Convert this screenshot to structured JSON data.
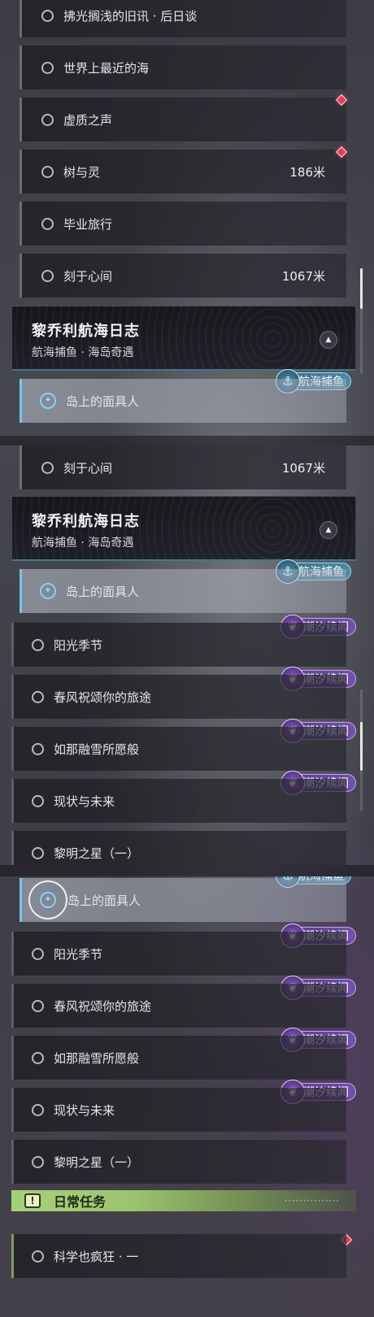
{
  "panel1": {
    "rows": [
      {
        "label": "拂光搁浅的旧讯 · 后日谈",
        "distance": ""
      },
      {
        "label": "世界上最近的海",
        "distance": ""
      },
      {
        "label": "虚质之声",
        "distance": ""
      },
      {
        "label": "树与灵",
        "distance": "186米"
      },
      {
        "label": "毕业旅行",
        "distance": ""
      },
      {
        "label": "刻于心间",
        "distance": "1067米"
      }
    ],
    "header": {
      "title": "黎乔利航海日志",
      "subtitle": "航海捕鱼 · 海岛奇遇"
    },
    "active_row": {
      "label": "岛上的面具人"
    },
    "tag_sea": "航海捕鱼"
  },
  "panel2": {
    "top_row": {
      "label": "刻于心间",
      "distance": "1067米"
    },
    "header": {
      "title": "黎乔利航海日志",
      "subtitle": "航海捕鱼 · 海岛奇遇"
    },
    "active_row": {
      "label": "岛上的面具人"
    },
    "tag_sea": "航海捕鱼",
    "rows": [
      {
        "label": "阳光季节",
        "tag": "潮汐续闻"
      },
      {
        "label": "春风祝颂你的旅途",
        "tag": "潮汐续闻"
      },
      {
        "label": "如那融雪所愿般",
        "tag": "潮汐续闻"
      },
      {
        "label": "现状与未来",
        "tag": "潮汐续闻"
      },
      {
        "label": "黎明之星（一）",
        "tag": ""
      }
    ]
  },
  "panel3": {
    "tag_sea": "航海捕鱼",
    "active_row": {
      "label": "岛上的面具人"
    },
    "rows": [
      {
        "label": "阳光季节",
        "tag": "潮汐续闻"
      },
      {
        "label": "春风祝颂你的旅途",
        "tag": "潮汐续闻"
      },
      {
        "label": "如那融雪所愿般",
        "tag": "潮汐续闻"
      },
      {
        "label": "现状与未来",
        "tag": "潮汐续闻"
      },
      {
        "label": "黎明之星（一）",
        "tag": ""
      }
    ],
    "daily": {
      "label": "日常任务",
      "row_label": "科学也疯狂 · 一"
    }
  },
  "icons": {
    "quest": "circle-outline-icon",
    "tracked": "compass-icon",
    "collapse": "triangle-up-icon",
    "marker": "red-diamond-icon",
    "daily": "exclamation-icon",
    "tag_sea": "fishing-icon",
    "tag_tide": "wave-feather-icon"
  },
  "colors": {
    "tracked_accent": "#74c5ea",
    "daily_accent": "#a9cf7a",
    "tide_tag": "#7350aa",
    "sea_tag": "#4d8aa6",
    "marker": "#e0405a"
  }
}
